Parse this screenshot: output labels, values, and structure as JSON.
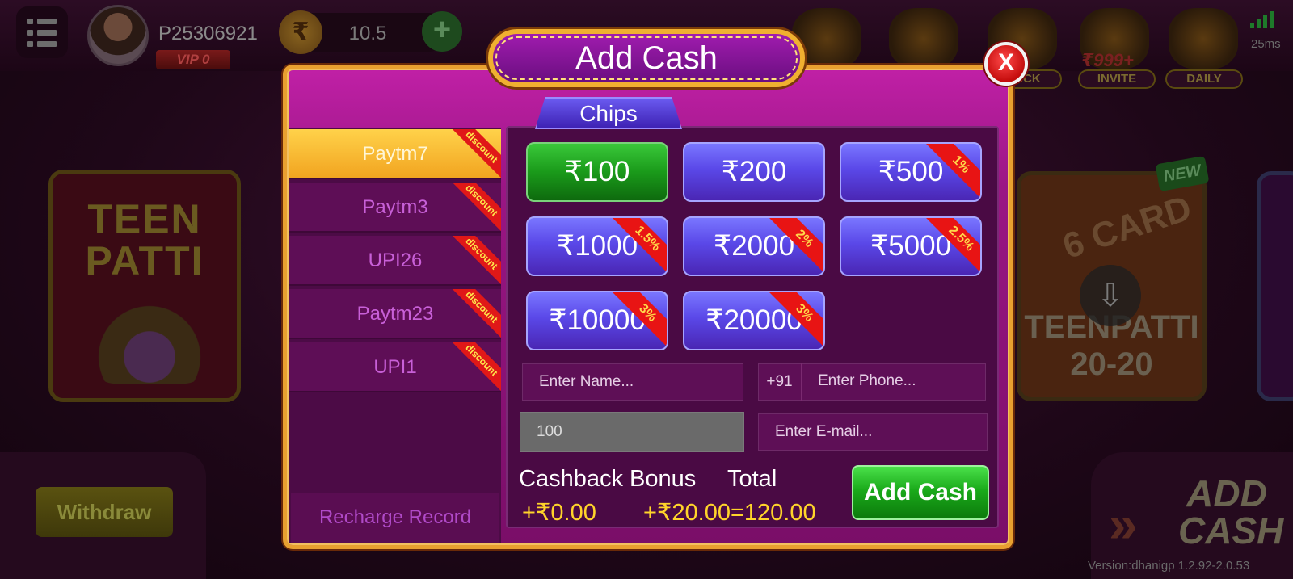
{
  "lobby": {
    "player_id": "P25306921",
    "vip": "VIP 0",
    "rupee_symbol": "₹",
    "balance": "10.5",
    "invite_amount": "₹999+",
    "top_labels": [
      "BACK",
      "INVITE",
      "DAILY"
    ],
    "ping": "25ms",
    "game_teenpatti": "TEEN PATTI",
    "game_6card": "TEENPATTI 20-20",
    "six_card": "6 CARD",
    "new_tag": "NEW",
    "withdraw_label": "Withdraw",
    "add_cash_art": "ADD CASH",
    "version": "Version:dhanigp 1.2.92-2.0.53"
  },
  "modal": {
    "title": "Add Cash",
    "close_label": "X",
    "tab": "Chips",
    "methods": [
      {
        "label": "Paytm7",
        "tag": "discount",
        "active": true
      },
      {
        "label": "Paytm3",
        "tag": "discount",
        "active": false
      },
      {
        "label": "UPI26",
        "tag": "discount",
        "active": false
      },
      {
        "label": "Paytm23",
        "tag": "discount",
        "active": false
      },
      {
        "label": "UPI1",
        "tag": "discount",
        "active": false
      }
    ],
    "recharge_record": "Recharge Record",
    "amounts": [
      {
        "label": "₹100",
        "bonus": "",
        "selected": true
      },
      {
        "label": "₹200",
        "bonus": "",
        "selected": false
      },
      {
        "label": "₹500",
        "bonus": "1%",
        "selected": false
      },
      {
        "label": "₹1000",
        "bonus": "1.5%",
        "selected": false
      },
      {
        "label": "₹2000",
        "bonus": "2%",
        "selected": false
      },
      {
        "label": "₹5000",
        "bonus": "2.5%",
        "selected": false
      },
      {
        "label": "₹10000",
        "bonus": "3%",
        "selected": false
      },
      {
        "label": "₹20000",
        "bonus": "3%",
        "selected": false
      }
    ],
    "name_placeholder": "Enter Name...",
    "phone_prefix": "+91",
    "phone_placeholder": "Enter Phone...",
    "amount_value": "100",
    "email_placeholder": "Enter E-mail...",
    "cashback_label": "Cashback Bonus",
    "total_label": "Total",
    "cashback_value": "+₹0.00",
    "total_value": "+₹20.00=120.00",
    "submit_label": "Add Cash"
  },
  "colors": {
    "modal_bg": "#9a1684",
    "modal_border": "#e8a030",
    "active_method": "#f2a420",
    "amount_button": "#5a48e8",
    "selected_amount": "#1a9a1a",
    "bonus_ribbon": "#e01818",
    "value_text": "#ffd42a",
    "submit_button": "#1aaa1a"
  }
}
